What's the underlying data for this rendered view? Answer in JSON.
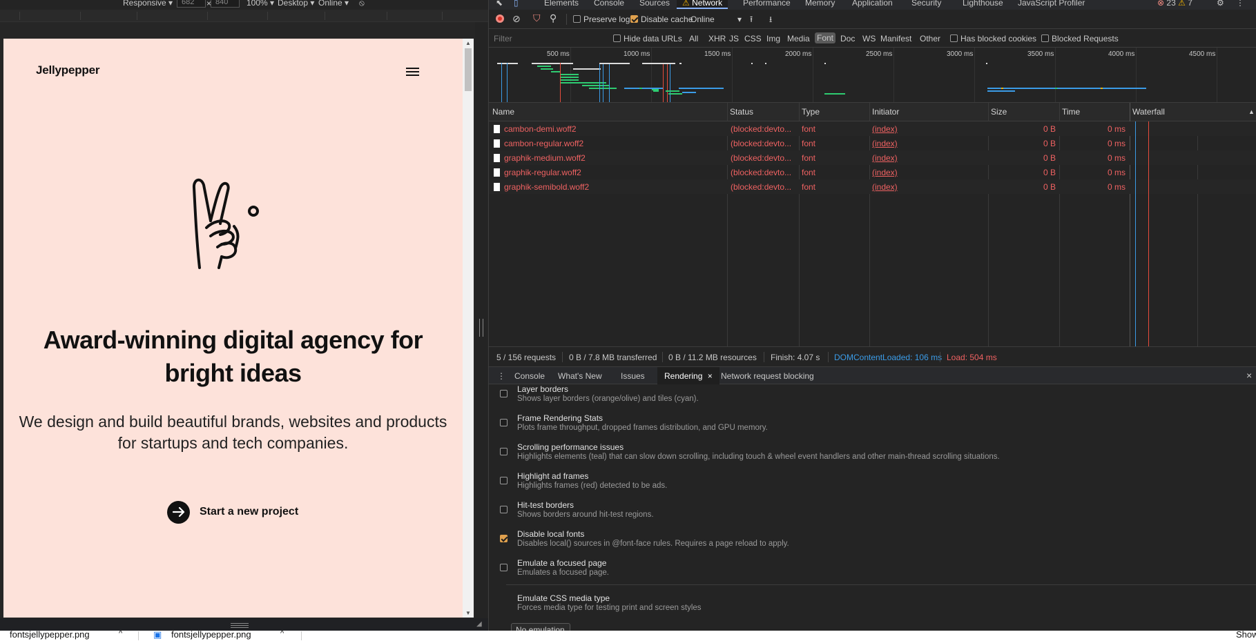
{
  "device_toolbar": {
    "device": "Responsive",
    "width": "682",
    "height": "840",
    "zoom": "100%",
    "mode": "Desktop",
    "throttling": "Online"
  },
  "page": {
    "logo": "Jellypepper",
    "menu_icon": "hamburger-icon",
    "illustration": "peace-hand-icon",
    "hero_title": "Award-winning digital agency for bright ideas",
    "hero_subtitle": "We design and build beautiful brands, websites and products for startups and tech companies.",
    "cta_label": "Start a new project",
    "cta_icon": "arrow-right-icon",
    "background_color": "#fde2da"
  },
  "devtools": {
    "tabs": [
      "Elements",
      "Console",
      "Sources",
      "Network",
      "Performance",
      "Memory",
      "Application",
      "Security",
      "Lighthouse",
      "JavaScript Profiler"
    ],
    "active_tab": "Network",
    "errors": "23",
    "warnings": "7",
    "toolbar": {
      "preserve_log": "Preserve log",
      "preserve_log_checked": false,
      "disable_cache": "Disable cache",
      "disable_cache_checked": true,
      "throttling": "Online"
    },
    "filter": {
      "placeholder": "Filter",
      "hide_data_urls": "Hide data URLs",
      "types": [
        "All",
        "XHR",
        "JS",
        "CSS",
        "Img",
        "Media",
        "Font",
        "Doc",
        "WS",
        "Manifest",
        "Other"
      ],
      "active_type": "Font",
      "has_blocked_cookies": "Has blocked cookies",
      "blocked_requests": "Blocked Requests"
    },
    "overview_ticks": [
      "500 ms",
      "1000 ms",
      "1500 ms",
      "2000 ms",
      "2500 ms",
      "3000 ms",
      "3500 ms",
      "4000 ms",
      "4500 ms"
    ],
    "columns": [
      "Name",
      "Status",
      "Type",
      "Initiator",
      "Size",
      "Time",
      "Waterfall"
    ],
    "requests": [
      {
        "name": "cambon-demi.woff2",
        "status": "(blocked:devto...",
        "type": "font",
        "initiator": "(index)",
        "size": "0 B",
        "time": "0 ms"
      },
      {
        "name": "cambon-regular.woff2",
        "status": "(blocked:devto...",
        "type": "font",
        "initiator": "(index)",
        "size": "0 B",
        "time": "0 ms"
      },
      {
        "name": "graphik-medium.woff2",
        "status": "(blocked:devto...",
        "type": "font",
        "initiator": "(index)",
        "size": "0 B",
        "time": "0 ms"
      },
      {
        "name": "graphik-regular.woff2",
        "status": "(blocked:devto...",
        "type": "font",
        "initiator": "(index)",
        "size": "0 B",
        "time": "0 ms"
      },
      {
        "name": "graphik-semibold.woff2",
        "status": "(blocked:devto...",
        "type": "font",
        "initiator": "(index)",
        "size": "0 B",
        "time": "0 ms"
      }
    ],
    "status_bar": {
      "requests": "5 / 156 requests",
      "transferred": "0 B / 7.8 MB transferred",
      "resources": "0 B / 11.2 MB resources",
      "finish": "Finish: 4.07 s",
      "dom_content_loaded": "DOMContentLoaded: 106 ms",
      "load": "Load: 504 ms"
    },
    "drawer_tabs": [
      "Console",
      "What's New",
      "Issues",
      "Rendering",
      "Network request blocking"
    ],
    "active_drawer_tab": "Rendering",
    "rendering_options": [
      {
        "title": "Layer borders",
        "desc": "Shows layer borders (orange/olive) and tiles (cyan).",
        "checked": false
      },
      {
        "title": "Frame Rendering Stats",
        "desc": "Plots frame throughput, dropped frames distribution, and GPU memory.",
        "checked": false
      },
      {
        "title": "Scrolling performance issues",
        "desc": "Highlights elements (teal) that can slow down scrolling, including touch & wheel event handlers and other main-thread scrolling situations.",
        "checked": false
      },
      {
        "title": "Highlight ad frames",
        "desc": "Highlights frames (red) detected to be ads.",
        "checked": false
      },
      {
        "title": "Hit-test borders",
        "desc": "Shows borders around hit-test regions.",
        "checked": false
      },
      {
        "title": "Disable local fonts",
        "desc": "Disables local() sources in @font-face rules. Requires a page reload to apply.",
        "checked": true
      },
      {
        "title": "Emulate a focused page",
        "desc": "Emulates a focused page.",
        "checked": false
      }
    ],
    "emulate_media": {
      "title": "Emulate CSS media type",
      "desc": "Forces media type for testing print and screen styles",
      "value": "No emulation"
    },
    "colors": {
      "error_red": "#ef6262",
      "dcl_blue": "#3b9ce8",
      "accent_checkbox": "#e0a14e"
    }
  },
  "taskbar": {
    "files": [
      "fontsjellypepper.png",
      "fontsjellypepper.png"
    ],
    "show_all": "Show"
  }
}
